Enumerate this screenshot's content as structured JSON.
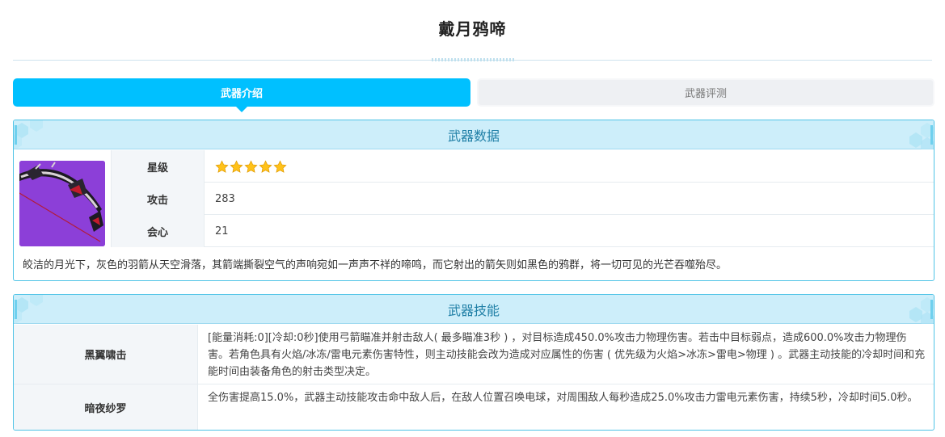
{
  "page": {
    "title": "戴月鸦啼"
  },
  "tabs": [
    {
      "label": "武器介绍",
      "active": true
    },
    {
      "label": "武器评测",
      "active": false
    }
  ],
  "weapon_data": {
    "heading": "武器数据",
    "image_icon": "weapon-bow-image",
    "rows": [
      {
        "label": "星级",
        "stars": 5
      },
      {
        "label": "攻击",
        "value": "283"
      },
      {
        "label": "会心",
        "value": "21"
      }
    ],
    "description": "皎洁的月光下，灰色的羽箭从天空滑落，其箭端撕裂空气的声响宛如一声声不祥的啼鸣，而它射出的箭矢则如黑色的鸦群，将一切可见的光芒吞噬殆尽。"
  },
  "weapon_skills": {
    "heading": "武器技能",
    "rows": [
      {
        "name": "黑翼啸击",
        "text": "[能量消耗:0][冷却:0秒]使用弓箭瞄准并射击敌人( 最多瞄准3秒 ) ，对目标造成450.0%攻击力物理伤害。若击中目标弱点，造成600.0%攻击力物理伤害。若角色具有火焰/冰冻/雷电元素伤害特性，则主动技能会改为造成对应属性的伤害 ( 优先级为火焰>冰冻>雷电>物理 ) 。武器主动技能的冷却时间和充能时间由装备角色的射击类型决定。"
      },
      {
        "name": "暗夜纱罗",
        "text": "全伤害提高15.0%，武器主动技能攻击命中敌人后，在敌人位置召唤电球，对周围敌人每秒造成25.0%攻击力雷电元素伤害，持续5秒，冷却时间5.0秒。"
      }
    ]
  },
  "colors": {
    "accent": "#00c0ff",
    "panel_border": "#4fc3e6",
    "panel_head_bg": "#cdeefa",
    "heading_text": "#1f7fa6",
    "star": "#ffc21a"
  }
}
